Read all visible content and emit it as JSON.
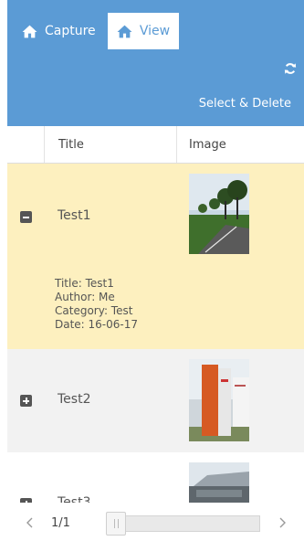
{
  "header": {
    "tabs": [
      {
        "label": "Capture",
        "icon": "home-icon"
      },
      {
        "label": "View",
        "icon": "home-icon",
        "active": true
      }
    ],
    "select_delete": "Select & Delete",
    "refresh_icon": "refresh-icon",
    "colors": {
      "bar": "#5b9bd5",
      "active_tab_text": "#5b9bd5"
    }
  },
  "table": {
    "columns": [
      "Title",
      "Image"
    ],
    "rows": [
      {
        "title": "Test1",
        "expanded": true,
        "details": [
          "Title: Test1",
          "Author: Me",
          "Category: Test",
          "Date: 16-06-17"
        ]
      },
      {
        "title": "Test2",
        "expanded": false
      },
      {
        "title": "Test3",
        "expanded": false
      }
    ]
  },
  "pager": {
    "info": "1/1"
  }
}
